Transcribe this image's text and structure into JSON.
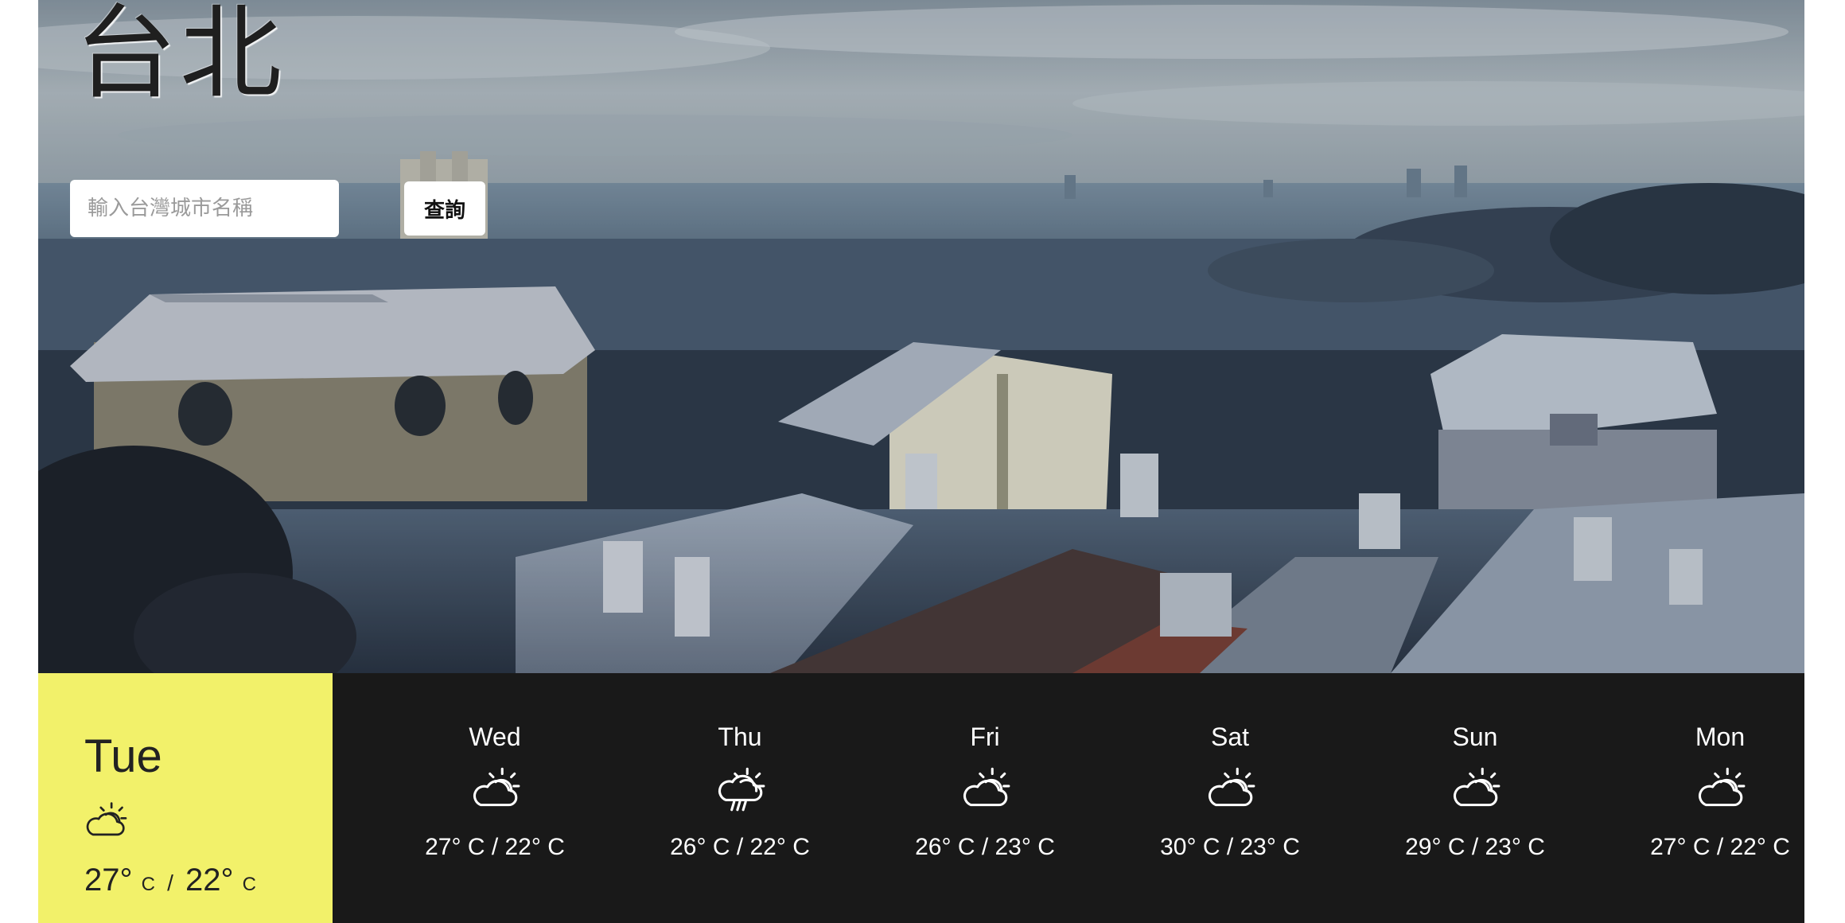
{
  "hero": {
    "city_name": "台北",
    "search": {
      "placeholder": "輸入台灣城市名稱",
      "value": "",
      "button_label": "查詢"
    },
    "background_icon": "city-rooftops-photo"
  },
  "today": {
    "day": "Tue",
    "icon": "partly-cloudy-icon",
    "high": "27°",
    "low": "22°",
    "unit": "C",
    "separator": "/",
    "background_color": "#f2f16a"
  },
  "forecast": [
    {
      "day": "Wed",
      "icon": "partly-cloudy-icon",
      "temps": "27° C / 22° C"
    },
    {
      "day": "Thu",
      "icon": "partly-cloudy-rain-icon",
      "temps": "26° C / 22° C"
    },
    {
      "day": "Fri",
      "icon": "partly-cloudy-icon",
      "temps": "26° C / 23° C"
    },
    {
      "day": "Sat",
      "icon": "partly-cloudy-icon",
      "temps": "30° C / 23° C"
    },
    {
      "day": "Sun",
      "icon": "partly-cloudy-icon",
      "temps": "29° C / 23° C"
    },
    {
      "day": "Mon",
      "icon": "partly-cloudy-icon",
      "temps": "27° C / 22° C"
    }
  ],
  "colors": {
    "forecast_background": "#191919",
    "today_accent": "#f2f16a",
    "text_light": "#ffffff"
  }
}
